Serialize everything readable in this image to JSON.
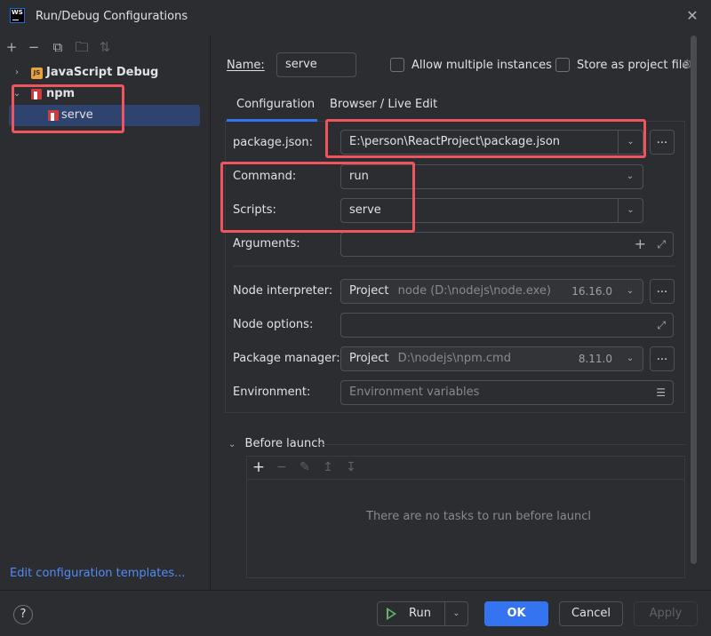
{
  "window": {
    "title": "Run/Debug Configurations",
    "logo_text": "WS"
  },
  "tree": {
    "groups": [
      {
        "label": "JavaScript Debug",
        "icon": "js-icon",
        "expanded": false
      },
      {
        "label": "npm",
        "icon": "npm-icon",
        "expanded": true,
        "children": [
          {
            "label": "serve",
            "selected": true
          }
        ]
      }
    ],
    "js_badge": "JS",
    "edit_templates": "Edit configuration templates..."
  },
  "form": {
    "name_label": "Name:",
    "name_value": "serve",
    "allow_multiple_label": "Allow multiple instances",
    "store_as_file_label": "Store as project file",
    "tabs": [
      "Configuration",
      "Browser / Live Edit"
    ],
    "package_json_label": "package.json:",
    "package_json_value": "E:\\person\\ReactProject\\package.json",
    "command_label": "Command:",
    "command_value": "run",
    "scripts_label": "Scripts:",
    "scripts_value": "serve",
    "arguments_label": "Arguments:",
    "node_interpreter_label": "Node interpreter:",
    "node_interpreter_kind": "Project",
    "node_interpreter_path": "node (D:\\nodejs\\node.exe)",
    "node_interpreter_version": "16.16.0",
    "node_options_label": "Node options:",
    "package_manager_label": "Package manager:",
    "package_manager_kind": "Project",
    "package_manager_path": "D:\\nodejs\\npm.cmd",
    "package_manager_version": "8.11.0",
    "environment_label": "Environment:",
    "environment_placeholder": "Environment variables",
    "ellipsis": "..."
  },
  "before_launch": {
    "title": "Before launch",
    "empty_text": "There are no tasks to run before launcl"
  },
  "footer": {
    "help": "?",
    "run": "Run",
    "ok": "OK",
    "cancel": "Cancel",
    "apply": "Apply"
  },
  "colors": {
    "accent": "#3574f0",
    "highlight_box": "#f0545f",
    "run_icon": "#5fb865"
  }
}
